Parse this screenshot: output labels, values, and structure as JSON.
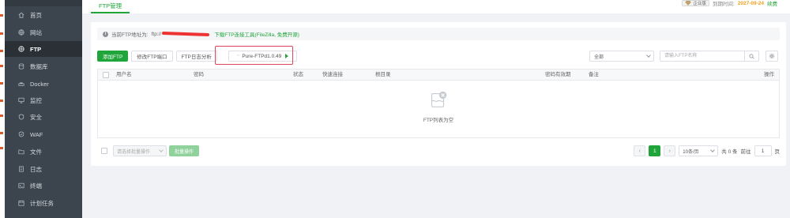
{
  "sidebar": {
    "items": [
      {
        "label": "首页",
        "icon": "home-icon"
      },
      {
        "label": "网站",
        "icon": "globe-icon"
      },
      {
        "label": "FTP",
        "icon": "ftp-icon",
        "active": true
      },
      {
        "label": "数据库",
        "icon": "database-icon"
      },
      {
        "label": "Docker",
        "icon": "docker-icon"
      },
      {
        "label": "监控",
        "icon": "monitor-icon"
      },
      {
        "label": "安全",
        "icon": "shield-icon"
      },
      {
        "label": "WAF",
        "icon": "waf-icon"
      },
      {
        "label": "文件",
        "icon": "folder-icon"
      },
      {
        "label": "日志",
        "icon": "log-icon"
      },
      {
        "label": "终端",
        "icon": "terminal-icon"
      },
      {
        "label": "计划任务",
        "icon": "calendar-icon"
      }
    ]
  },
  "header": {
    "tab_label": "FTP管理",
    "badge": "企业版",
    "expire_label": "到期时间:",
    "expire_date": "2027-09-24",
    "renew": "续费"
  },
  "notice": {
    "prefix": "当前FTP地址为:",
    "address": "ftp://",
    "link": "下载FTP连接工具(FileZilla, 免费开源)"
  },
  "toolbar": {
    "add": "添加FTP",
    "port": "修改FTP端口",
    "log": "FTP日志分析",
    "service": "Pure-FTPd1.0.49"
  },
  "filter": {
    "selected": "全部",
    "search_placeholder": "请输入FTP名称"
  },
  "table": {
    "columns": [
      "用户名",
      "密码",
      "状态",
      "快速连接",
      "根目录",
      "密码有效期",
      "备注",
      "操作"
    ],
    "empty_text": "FTP列表为空"
  },
  "footer": {
    "batch_placeholder": "请选择批量操作",
    "batch_button": "批量操作",
    "current_page": "1",
    "page_size": "10条/页",
    "total": "共 0 条",
    "goto_label": "前往",
    "goto_value": "1",
    "page_suffix": "页"
  },
  "colors": {
    "accent": "#20a53a",
    "sidebar": "#3c444d",
    "highlight": "#e0445a"
  }
}
